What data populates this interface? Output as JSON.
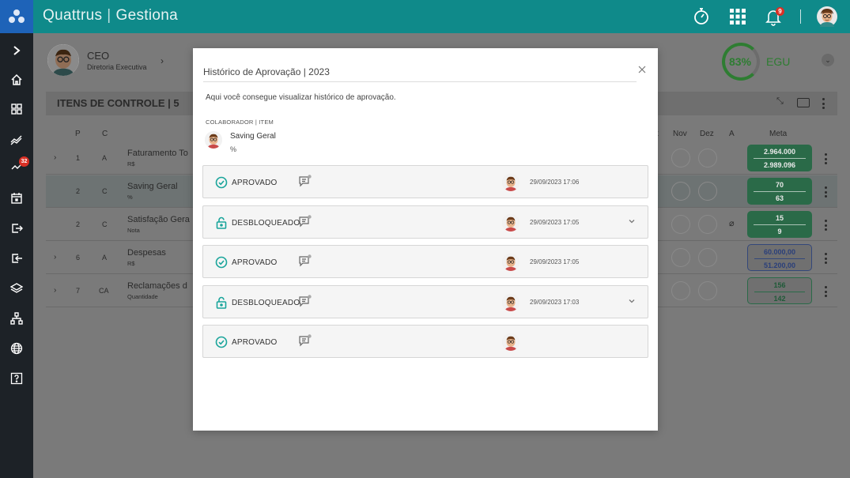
{
  "app": {
    "brand_left": "Quattrus",
    "brand_separator": "|",
    "brand_right": "Gestiona",
    "notification_count": "9",
    "accent_color": "#0f8a8a",
    "logo_bg": "#1e63b8"
  },
  "sidebar": {
    "items": [
      {
        "icon": "chevron-right-icon"
      },
      {
        "icon": "home-icon"
      },
      {
        "icon": "dashboard-icon"
      },
      {
        "icon": "trend-icon"
      },
      {
        "icon": "alert-icon",
        "badge": "32"
      },
      {
        "icon": "calendar-icon"
      },
      {
        "icon": "export-icon"
      },
      {
        "icon": "import-icon"
      },
      {
        "icon": "layers-icon"
      },
      {
        "icon": "org-chart-icon"
      },
      {
        "icon": "globe-icon"
      },
      {
        "icon": "help-icon"
      }
    ]
  },
  "background": {
    "user_role": "CEO",
    "user_dept": "Diretoria Executiva",
    "score": "83%",
    "score_label": "EGU",
    "section_title": "ITENS DE CONTROLE | 5",
    "col_p": "P",
    "col_c": "C",
    "col_t": "t",
    "col_nov": "Nov",
    "col_dez": "Dez",
    "col_a": "A",
    "col_meta": "Meta",
    "rows": [
      {
        "p": "1",
        "c": "A",
        "name": "Faturamento To",
        "unit": "R$",
        "meta1": "2.964.000",
        "meta2": "2.989.096"
      },
      {
        "p": "2",
        "c": "C",
        "name": "Saving Geral",
        "unit": "%",
        "meta1": "70",
        "meta2": "63"
      },
      {
        "p": "2",
        "c": "C",
        "name": "Satisfação Gera",
        "unit": "Nota",
        "meta1": "15",
        "meta2": "9"
      },
      {
        "p": "6",
        "c": "A",
        "name": "Despesas",
        "unit": "R$",
        "meta1": "60.000,00",
        "meta2": "51.200,00"
      },
      {
        "p": "7",
        "c": "CA",
        "name": "Reclamações d",
        "unit": "Quantidade",
        "meta1": "156",
        "meta2": "142"
      }
    ]
  },
  "modal": {
    "title": "Histórico de Aprovação | 2023",
    "description": "Aqui você consegue visualizar histórico de aprovação.",
    "colab_label": "COLABORADOR | ITEM",
    "item_name": "Saving Geral",
    "item_unit": "%",
    "history": [
      {
        "status": "APROVADO",
        "type": "approved",
        "date": "29/09/2023 17:06",
        "expandable": false
      },
      {
        "status": "DESBLOQUEADO",
        "type": "unlocked",
        "date": "29/09/2023 17:05",
        "expandable": true
      },
      {
        "status": "APROVADO",
        "type": "approved",
        "date": "29/09/2023 17:05",
        "expandable": false
      },
      {
        "status": "DESBLOQUEADO",
        "type": "unlocked",
        "date": "29/09/2023 17:03",
        "expandable": true
      },
      {
        "status": "APROVADO",
        "type": "approved",
        "date": "",
        "expandable": false
      }
    ],
    "status_color": "#1aa59b"
  }
}
